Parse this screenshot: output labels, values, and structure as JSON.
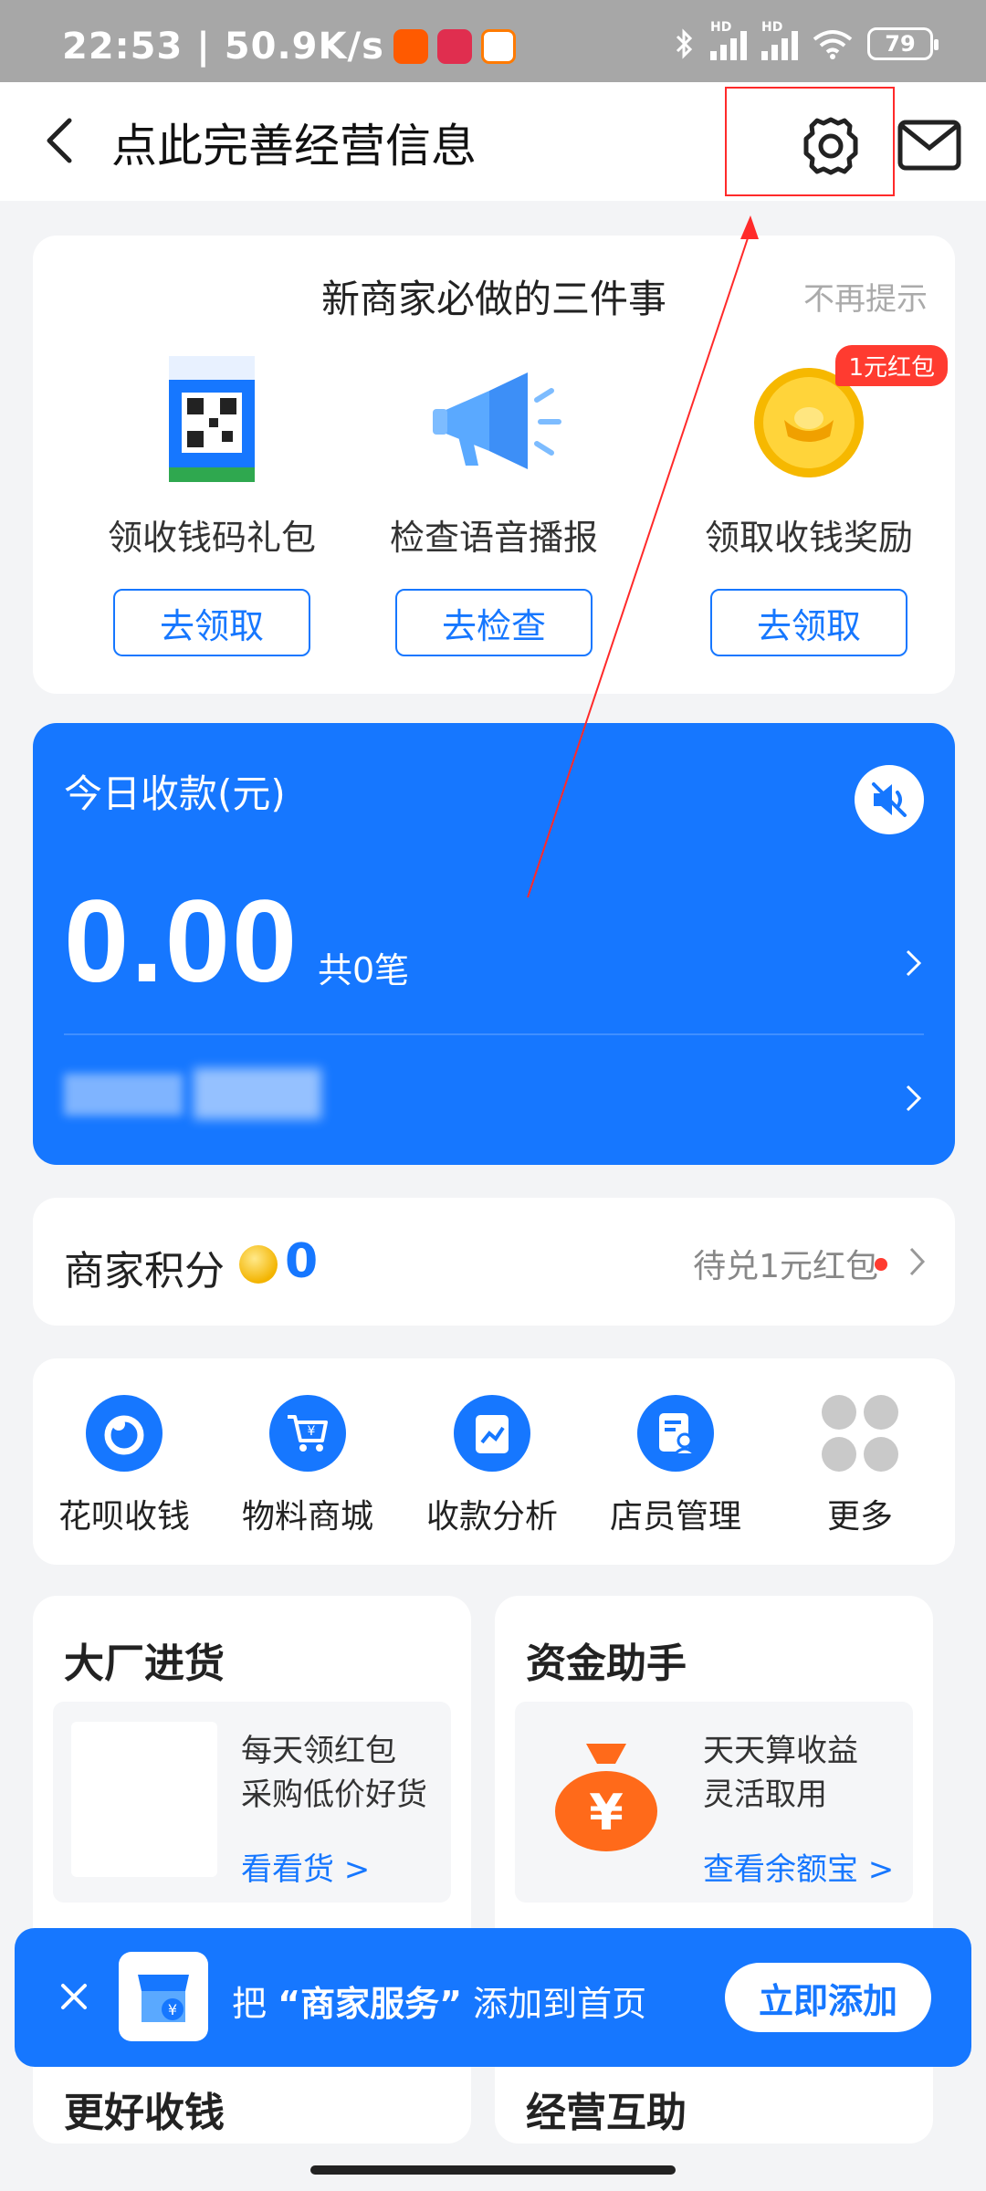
{
  "status_bar": {
    "time_speed": "22:53 | 50.9K/s",
    "signal_1_label": "HD",
    "signal_2_label": "HD",
    "battery": "79"
  },
  "nav": {
    "title": "点此完善经营信息",
    "icons": [
      "back-icon",
      "gear-icon",
      "mail-icon"
    ]
  },
  "onboarding": {
    "title": "新商家必做的三件事",
    "dismiss": "不再提示",
    "tasks": [
      {
        "label": "领收钱码礼包",
        "button": "去领取",
        "image": "qr-code-stand"
      },
      {
        "label": "检查语音播报",
        "button": "去检查",
        "image": "megaphone"
      },
      {
        "label": "领取收钱奖励",
        "button": "去领取",
        "image": "gold-coin",
        "badge": "1元红包"
      }
    ]
  },
  "earnings": {
    "label": "今日收款(元)",
    "amount": "0.00",
    "count": "共0笔"
  },
  "points": {
    "label": "商家积分",
    "value": "0",
    "note": "待兑1元红包"
  },
  "actions": [
    {
      "label": "花呗收钱",
      "icon": "huabei-icon"
    },
    {
      "label": "物料商城",
      "icon": "cart-icon"
    },
    {
      "label": "收款分析",
      "icon": "chart-icon"
    },
    {
      "label": "店员管理",
      "icon": "staff-icon"
    },
    {
      "label": "更多",
      "icon": "more-icon"
    }
  ],
  "cards": [
    {
      "title": "大厂进货",
      "line1": "每天领红包",
      "line2": "采购低价好货",
      "link": "看看货 >",
      "bottom_title": "更好收钱"
    },
    {
      "title": "资金助手",
      "line1": "天天算收益",
      "line2": "灵活取用",
      "link": "查看余额宝 >",
      "bottom_title": "经营互助"
    }
  ],
  "banner": {
    "prefix": "把",
    "highlight": "“商家服务”",
    "suffix": "添加到首页",
    "button": "立即添加"
  },
  "colors": {
    "primary": "#1677ff",
    "background": "#f3f4f6",
    "status_bar": "#a7a7a7",
    "badge_red": "#ff3b30",
    "annotation": "#ff2a2a"
  }
}
